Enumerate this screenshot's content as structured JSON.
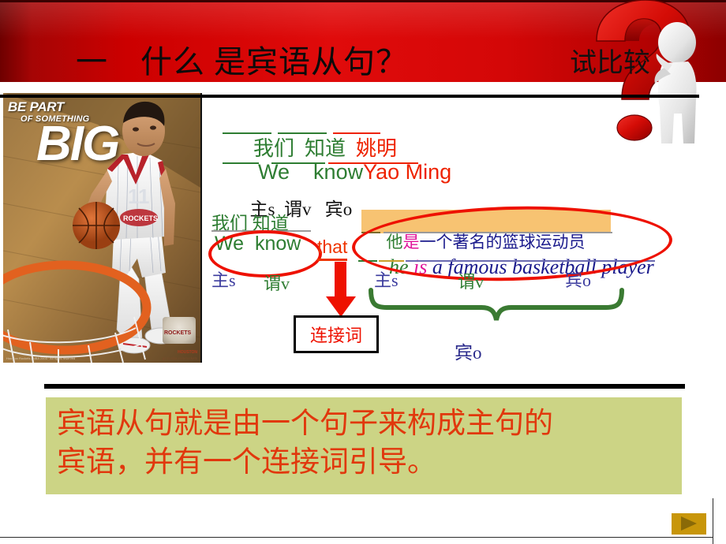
{
  "slide": {
    "header": {
      "title": "一 什么 是宾语从句？",
      "compare_label": "试比较",
      "band_color": "#cc0000"
    },
    "poster": {
      "line1": "BE PART",
      "line2": "OF SOMETHING",
      "line3": "BIG",
      "badge_text": "ROCKETS",
      "badge_sub": "HOUSTON",
      "badge_sub2": "go to nba.com/rockets",
      "credit": "Houston Rockets / NBA 2003 · All rights reserved"
    },
    "example1": {
      "chinese": [
        {
          "text": "我们",
          "color": "#2e7d32"
        },
        {
          "text": "知道",
          "color": "#2e7d32"
        },
        {
          "text": "姚明",
          "color": "#ee2200"
        }
      ],
      "chinese_plain": "我们  知道  姚明",
      "english": [
        {
          "text": "We",
          "color": "#2e7d32"
        },
        {
          "text": "know",
          "color": "#2e7d32"
        },
        {
          "text": "Yao Ming",
          "color": "#ee2200"
        }
      ],
      "english_plain": "We    know Yao Ming",
      "roles": "主s   谓v     宾o",
      "role_subject": "主s",
      "role_verb": "谓v",
      "role_object": "宾o"
    },
    "example2": {
      "main_clause_chinese": "我们 知道",
      "main_clause_english": "We  know",
      "connector": "that",
      "sub_clause_chinese": [
        {
          "text": "他",
          "color": "#2e7d32"
        },
        {
          "text": "是",
          "color": "#e0159b"
        },
        {
          "text": "一个著名的篮球运动员",
          "color": "#1a1a8c"
        }
      ],
      "sub_clause_chinese_plain": "他是一个著名的篮球运动员",
      "sub_clause_english": [
        {
          "text": "he",
          "color": "#2e7d32"
        },
        {
          "text": "is",
          "color": "#e0159b"
        },
        {
          "text": "a famous basketball player",
          "color": "#1a1a8c"
        }
      ],
      "sub_clause_english_plain": "he is a famous basketball player",
      "main_role_subject": "主s",
      "main_role_verb": "谓v",
      "sub_role_subject": "主s",
      "sub_role_verb": "谓v",
      "sub_role_object": "宾o",
      "connector_box_label": "连接词",
      "brace_label": "宾o",
      "highlight_color": "#f7c372",
      "ellipse_color": "#ee1100"
    },
    "summary": {
      "text": "宾语从句就是由一个句子来构成主句的\n宾语，并有一个连接词引导。",
      "background": "#ccd485",
      "text_color": "#e1380d"
    },
    "nav": {
      "next_label": "next-slide"
    }
  }
}
